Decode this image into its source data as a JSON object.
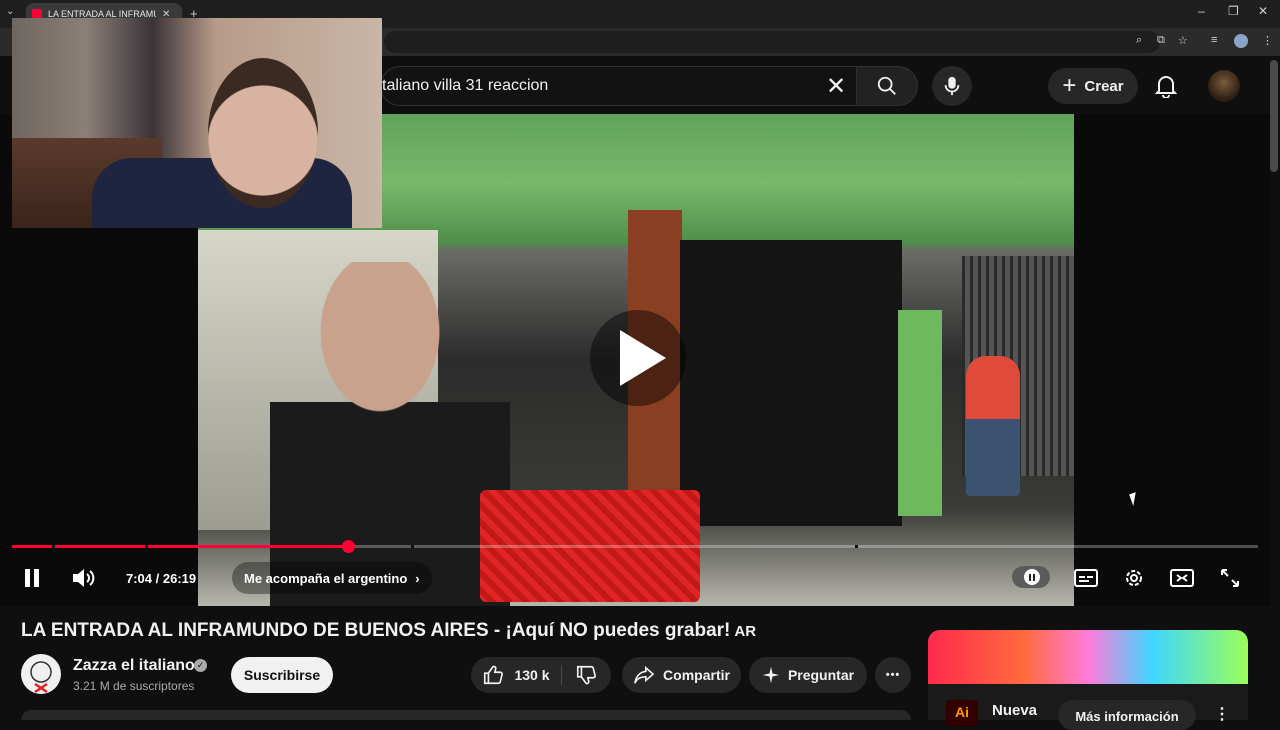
{
  "browser": {
    "tab_title": "LA ENTRADA AL INFRAMUNDO",
    "tab_close": "✕",
    "new_tab": "+",
    "win_min": "–",
    "win_max": "❐",
    "win_close": "✕"
  },
  "header": {
    "search_query": "taliano villa 31 reaccion",
    "create_label": "Crear"
  },
  "player": {
    "time_current": "7:04",
    "time_sep": " / ",
    "time_total": "26:19",
    "chapter_title": "Me acompaña el argentino",
    "progress_fraction": 0.27
  },
  "video": {
    "title": "LA ENTRADA AL INFRAMUNDO DE BUENOS AIRES - ¡Aquí NO puedes grabar!",
    "title_badge": "AR"
  },
  "channel": {
    "name": "Zazza el italiano",
    "subscribers": "3.21 M de suscriptores",
    "verified_mark": "✓",
    "subscribe_label": "Suscribirse"
  },
  "actions": {
    "like_count": "130 k",
    "share_label": "Compartir",
    "ask_label": "Preguntar",
    "more_label": "•••"
  },
  "ad": {
    "logo_text": "Ai",
    "title": "Nueva",
    "cta_label": "Más información",
    "menu": "⋮"
  },
  "colors": {
    "accent": "#ff0033",
    "background": "#0f0f0f",
    "surface": "#272727"
  }
}
